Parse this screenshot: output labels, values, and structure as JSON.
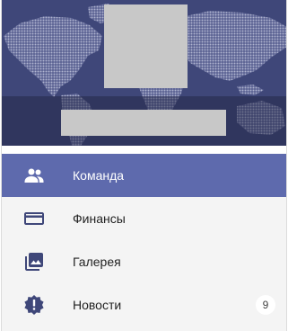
{
  "colors": {
    "header_background": "#3f4779",
    "active_item": "#5e6aad",
    "icon_color": "#3f4779",
    "placeholder_gray": "#c8c8c8"
  },
  "header": {
    "background_icon": "world-map-icon",
    "avatar_icon": "avatar-placeholder",
    "name_placeholder": "redacted-name-block"
  },
  "menu": {
    "items": [
      {
        "label": "Команда",
        "icon": "people-icon",
        "active": true
      },
      {
        "label": "Финансы",
        "icon": "credit-card-icon",
        "active": false
      },
      {
        "label": "Галерея",
        "icon": "photo-library-icon",
        "active": false
      },
      {
        "label": "Новости",
        "icon": "news-badge-icon",
        "active": false,
        "badge": "9"
      }
    ]
  }
}
